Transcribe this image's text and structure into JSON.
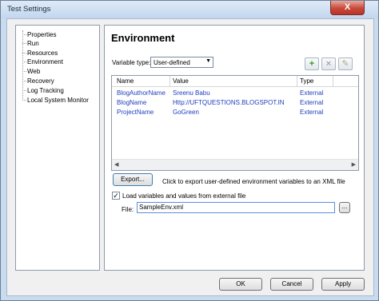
{
  "window": {
    "title": "Test Settings",
    "close_glyph": "X"
  },
  "nav": {
    "items": [
      {
        "label": "Properties"
      },
      {
        "label": "Run"
      },
      {
        "label": "Resources"
      },
      {
        "label": "Environment"
      },
      {
        "label": "Web"
      },
      {
        "label": "Recovery"
      },
      {
        "label": "Log Tracking"
      },
      {
        "label": "Local System Monitor"
      }
    ]
  },
  "main": {
    "heading": "Environment",
    "variable_type_label": "Variable type:",
    "variable_type_value": "User-defined",
    "toolbar": {
      "add_icon": "plus-icon",
      "delete_icon": "x-icon",
      "edit_icon": "pencil-icon"
    },
    "table": {
      "columns": [
        "Name",
        "Value",
        "Type"
      ],
      "rows": [
        {
          "name": "BlogAuthorName",
          "value": "Sreenu Babu",
          "type": "External"
        },
        {
          "name": "BlogName",
          "value": "Http://UFTQUESTIONS.BLOGSPOT.IN",
          "type": "External"
        },
        {
          "name": "ProjectName",
          "value": "GoGreen",
          "type": "External"
        }
      ]
    },
    "export_label": "Export...",
    "export_note": "Click to export user-defined environment variables to an XML file",
    "load_label": "Load variables and values from external file",
    "load_checked": true,
    "file_label": "File:",
    "file_value": "SampleEnv.xml",
    "browse_label": "..."
  },
  "footer": {
    "ok": "OK",
    "cancel": "Cancel",
    "apply": "Apply"
  }
}
